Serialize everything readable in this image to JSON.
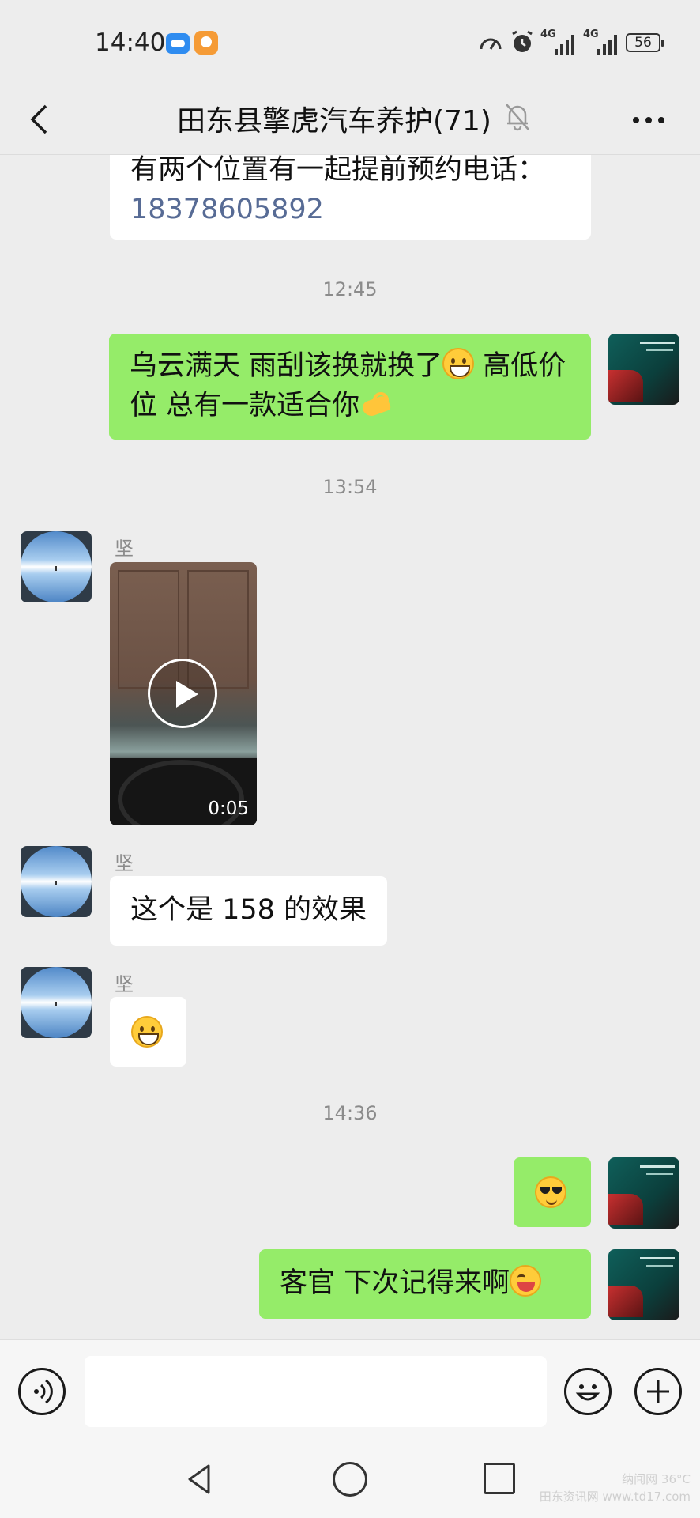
{
  "status_bar": {
    "time": "14:40",
    "network_1": "4G",
    "network_2": "4G",
    "battery": "56",
    "icons": [
      "cloud-app-icon",
      "shopping-app-icon",
      "speed-icon",
      "alarm-icon",
      "signal-icon",
      "signal-icon",
      "battery-icon"
    ]
  },
  "header": {
    "title": "田东县擎虎汽车养护(71)",
    "icons": [
      "back-icon",
      "mute-icon",
      "more-icon"
    ]
  },
  "messages": {
    "m1": {
      "line1": "有两个位置有一起提前预约电话：",
      "phone": "18378605892"
    },
    "ts1": "12:45",
    "m2": {
      "text_a": "乌云满天  雨刮该换就换了",
      "text_b": " 高低价位  总有一款适合你"
    },
    "ts2": "13:54",
    "m3": {
      "sender": "坚",
      "duration": "0:05"
    },
    "m4": {
      "sender": "坚",
      "text": "这个是 158 的效果"
    },
    "m5": {
      "sender": "坚"
    },
    "ts3": "14:36",
    "m7": {
      "text": "客官  下次记得来啊"
    }
  },
  "input_bar": {
    "placeholder": ""
  },
  "watermark": {
    "line1": "纳闻网 36°C",
    "line2": "田东资讯网 www.td17.com"
  },
  "colors": {
    "out_bubble": "#95ec69",
    "in_bubble": "#ffffff",
    "link": "#576b95",
    "background": "#ededed"
  }
}
